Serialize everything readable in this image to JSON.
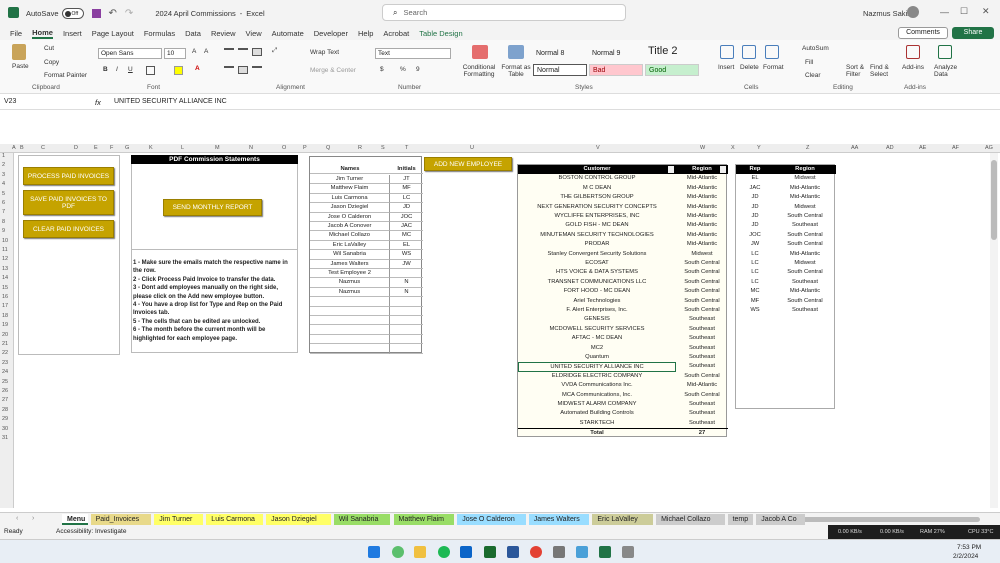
{
  "titlebar": {
    "autosave": "AutoSave",
    "autosave_state": "Off",
    "filename": "2024 April Commissions",
    "app": "Excel",
    "search_placeholder": "Search",
    "user": "Nazmus Sakib"
  },
  "menu": [
    "File",
    "Home",
    "Insert",
    "Page Layout",
    "Formulas",
    "Data",
    "Review",
    "View",
    "Automate",
    "Developer",
    "Help",
    "Acrobat",
    "Table Design"
  ],
  "menu_buttons": {
    "comments": "Comments",
    "share": "Share"
  },
  "ribbon": {
    "paste": "Paste",
    "cut": "Cut",
    "copy": "Copy",
    "format_painter": "Format Painter",
    "clipboard": "Clipboard",
    "font_name": "Open Sans",
    "font_size": "10",
    "font": "Font",
    "wrap": "Wrap Text",
    "merge": "Merge & Center",
    "alignment": "Alignment",
    "number_format": "Text",
    "number": "Number",
    "cond": "Conditional Formatting",
    "fmt_table": "Format as Table",
    "styles": "Styles",
    "normal8": "Normal 8",
    "normal9": "Normal 9",
    "title2": "Title 2",
    "normal": "Normal",
    "bad": "Bad",
    "good": "Good",
    "insert": "Insert",
    "delete": "Delete",
    "format": "Format",
    "cells": "Cells",
    "autosum": "AutoSum",
    "fill": "Fill",
    "clear": "Clear",
    "sort": "Sort & Filter",
    "find": "Find & Select",
    "editing": "Editing",
    "addins": "Add-ins",
    "analyze": "Analyze Data",
    "addins_grp": "Add-ins"
  },
  "formula_bar": {
    "cell_ref": "V23",
    "fx": "fx",
    "value": "UNITED SECURITY ALLIANCE INC"
  },
  "columns": [
    "A",
    "B",
    "C",
    "D",
    "E",
    "F",
    "G",
    "K",
    "L",
    "M",
    "N",
    "O",
    "P",
    "Q",
    "R",
    "S",
    "T",
    "U",
    "V",
    "W",
    "X",
    "Y",
    "Z",
    "AA",
    "AD",
    "AE",
    "AF",
    "AG"
  ],
  "buttons": {
    "process": "PROCESS PAID INVOICES",
    "save_pdf": "SAVE PAID INVOICES TO PDF",
    "clear": "CLEAR PAID INVOICES",
    "send_monthly": "SEND MONTHLY REPORT",
    "add_employee": "ADD NEW EMPLOYEE"
  },
  "pdf_title": "PDF Commission Statements",
  "instructions": [
    "1 - Make sure the emails match the respective name in the row.",
    "2 - Click Process Paid Invoice to transfer the data.",
    "3 - Dont add employees manually on the right side, please click on the Add new employee button.",
    "4 - You have a drop list for Type and Rep on the Paid Invoices tab.",
    "5 - The cells that can be edited are unlocked.",
    "6 - The month before the current month will be highlighted for each employee page."
  ],
  "names_table": {
    "headers": [
      "Names",
      "Initials"
    ],
    "rows": [
      [
        "Jim Turner",
        "JT"
      ],
      [
        "Matthew Flaim",
        "MF"
      ],
      [
        "Luis Carmona",
        "LC"
      ],
      [
        "Jason Dziegiel",
        "JD"
      ],
      [
        "Jose O Calderon",
        "JOC"
      ],
      [
        "Jacob A Conover",
        "JAC"
      ],
      [
        "Michael Collazo",
        "MC"
      ],
      [
        "Eric LaValley",
        "EL"
      ],
      [
        "Wil Sanabria",
        "WS"
      ],
      [
        "James Walters",
        "JW"
      ],
      [
        "Test Employee 2",
        ""
      ],
      [
        "Nazmus",
        "N"
      ],
      [
        "Nazmus",
        "N"
      ]
    ]
  },
  "customer_table": {
    "headers": [
      "Customer",
      "Region"
    ],
    "rows": [
      [
        "BOSTON CONTROL GROUP",
        "Mid-Atlantic"
      ],
      [
        "M C DEAN",
        "Mid-Atlantic"
      ],
      [
        "THE GILBERTSON GROUP",
        "Mid-Atlantic"
      ],
      [
        "NEXT GENERATION SECURITY CONCEPTS",
        "Mid-Atlantic"
      ],
      [
        "WYCLIFFE ENTERPRISES, INC",
        "Mid-Atlantic"
      ],
      [
        "GOLD FISH - MC DEAN",
        "Mid-Atlantic"
      ],
      [
        "MINUTEMAN SECURITY TECHNOLOGIES",
        "Mid-Atlantic"
      ],
      [
        "PRODAR",
        "Mid-Atlantic"
      ],
      [
        "Stanley Convergent Security Solutions",
        "Midwest"
      ],
      [
        "ECOSAT",
        "South Central"
      ],
      [
        "HTS VOICE & DATA SYSTEMS",
        "South Central"
      ],
      [
        "TRANSNET COMMUNICATIONS LLC",
        "South Central"
      ],
      [
        "FORT HOOD - MC DEAN",
        "South Central"
      ],
      [
        "Ariel Technologies",
        "South Central"
      ],
      [
        "F. Alert Enterprises, Inc.",
        "South Central"
      ],
      [
        "GENESIS",
        "Southeast"
      ],
      [
        "MCDOWELL SECURITY SERVICES",
        "Southeast"
      ],
      [
        "AFTAC - MC DEAN",
        "Southeast"
      ],
      [
        "MC2",
        "Southeast"
      ],
      [
        "Quantum",
        "Southeast"
      ],
      [
        "UNITED SECURITY ALLIANCE INC",
        "Southeast"
      ],
      [
        "ELDRIDGE ELECTRIC COMPANY",
        "South Central"
      ],
      [
        "VVDA Communications Inc.",
        "Mid-Atlantic"
      ],
      [
        "MCA Communications, Inc.",
        "South Central"
      ],
      [
        "MIDWEST ALARM COMPANY",
        "Southeast"
      ],
      [
        "Automated Building Controls",
        "Southeast"
      ],
      [
        "STARKTECH",
        "Southeast"
      ]
    ],
    "total_label": "Total",
    "total_value": "27"
  },
  "rep_table": {
    "headers": [
      "Rep",
      "Region"
    ],
    "rows": [
      [
        "EL",
        "Midwest"
      ],
      [
        "JAC",
        "Mid-Atlantic"
      ],
      [
        "JD",
        "Mid-Atlantic"
      ],
      [
        "JD",
        "Midwest"
      ],
      [
        "JD",
        "South Central"
      ],
      [
        "JD",
        "Southeast"
      ],
      [
        "JOC",
        "South Central"
      ],
      [
        "JW",
        "South Central"
      ],
      [
        "LC",
        "Mid-Atlantic"
      ],
      [
        "LC",
        "Midwest"
      ],
      [
        "LC",
        "South Central"
      ],
      [
        "LC",
        "Southeast"
      ],
      [
        "MC",
        "Mid-Atlantic"
      ],
      [
        "MF",
        "South Central"
      ],
      [
        "WS",
        "Southeast"
      ]
    ]
  },
  "sheet_tabs": [
    {
      "name": "Menu",
      "color": "#ffffff"
    },
    {
      "name": "Paid_Invoices",
      "color": "#e8d98a"
    },
    {
      "name": "Jim Turner",
      "color": "#ffff66"
    },
    {
      "name": "Luis Carmona",
      "color": "#ffff66"
    },
    {
      "name": "Jason Dziegiel",
      "color": "#ffff66"
    },
    {
      "name": "Wil Sanabria",
      "color": "#99dd66"
    },
    {
      "name": "Matthew Flaim",
      "color": "#99dd66"
    },
    {
      "name": "Jose O Calderon",
      "color": "#99ddff"
    },
    {
      "name": "James Walters",
      "color": "#99ddff"
    },
    {
      "name": "Eric LaValley",
      "color": "#cccc99"
    },
    {
      "name": "Michael Collazo",
      "color": "#cccccc"
    },
    {
      "name": "temp",
      "color": "#cccccc"
    },
    {
      "name": "Jacob A Co",
      "color": "#cccccc"
    }
  ],
  "status": {
    "ready": "Ready",
    "accessibility": "Accessibility: Investigate",
    "net_up": "0.00 KB/s",
    "net_down": "0.00 KB/s",
    "ram": "RAM 27%",
    "cpu": "CPU",
    "cpu_val": "CPU 33°C"
  },
  "taskbar": {
    "time": "7:53 PM",
    "date": "2/2/2024"
  },
  "colors": {
    "excel_green": "#217346",
    "button_gold": "#c5a300",
    "header_black": "#000000"
  }
}
